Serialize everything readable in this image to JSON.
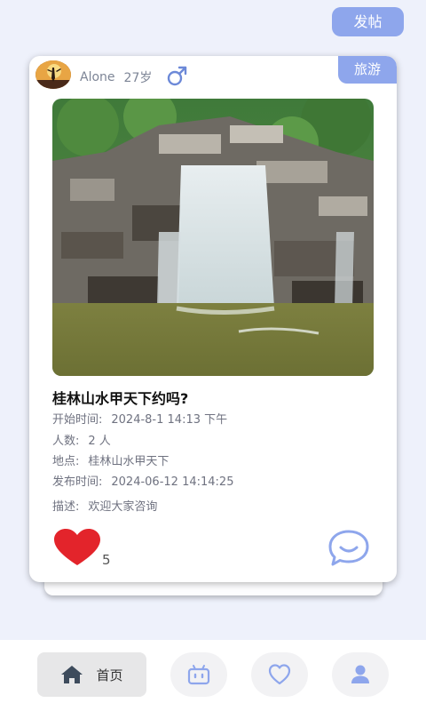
{
  "header": {
    "post_button_label": "发帖"
  },
  "post": {
    "category": "旅游",
    "user": {
      "name": "Alone",
      "age": "27岁",
      "gender_icon": "male-icon"
    },
    "title": "桂林山水甲天下约吗?",
    "info": [
      {
        "key": "开始时间:",
        "value": "2024-8-1 14:13 下午"
      },
      {
        "key": "人数:",
        "value": "2 人"
      },
      {
        "key": "地点:",
        "value": "桂林山水甲天下"
      },
      {
        "key": "发布时间:",
        "value": "2024-06-12 14:14:25"
      },
      {
        "key": "描述:",
        "value": "欢迎大家咨询"
      }
    ],
    "likes": "5",
    "heart_color": "#e3242b"
  },
  "bottom_nav": {
    "items": [
      {
        "label": "首页",
        "icon": "home-icon",
        "active": true
      },
      {
        "icon": "robot-icon"
      },
      {
        "icon": "heart-outline-icon"
      },
      {
        "icon": "user-icon"
      }
    ]
  },
  "colors": {
    "accent": "#8ea6ec",
    "icon": "#8ea6ec",
    "home_icon": "#3d4b5c"
  }
}
